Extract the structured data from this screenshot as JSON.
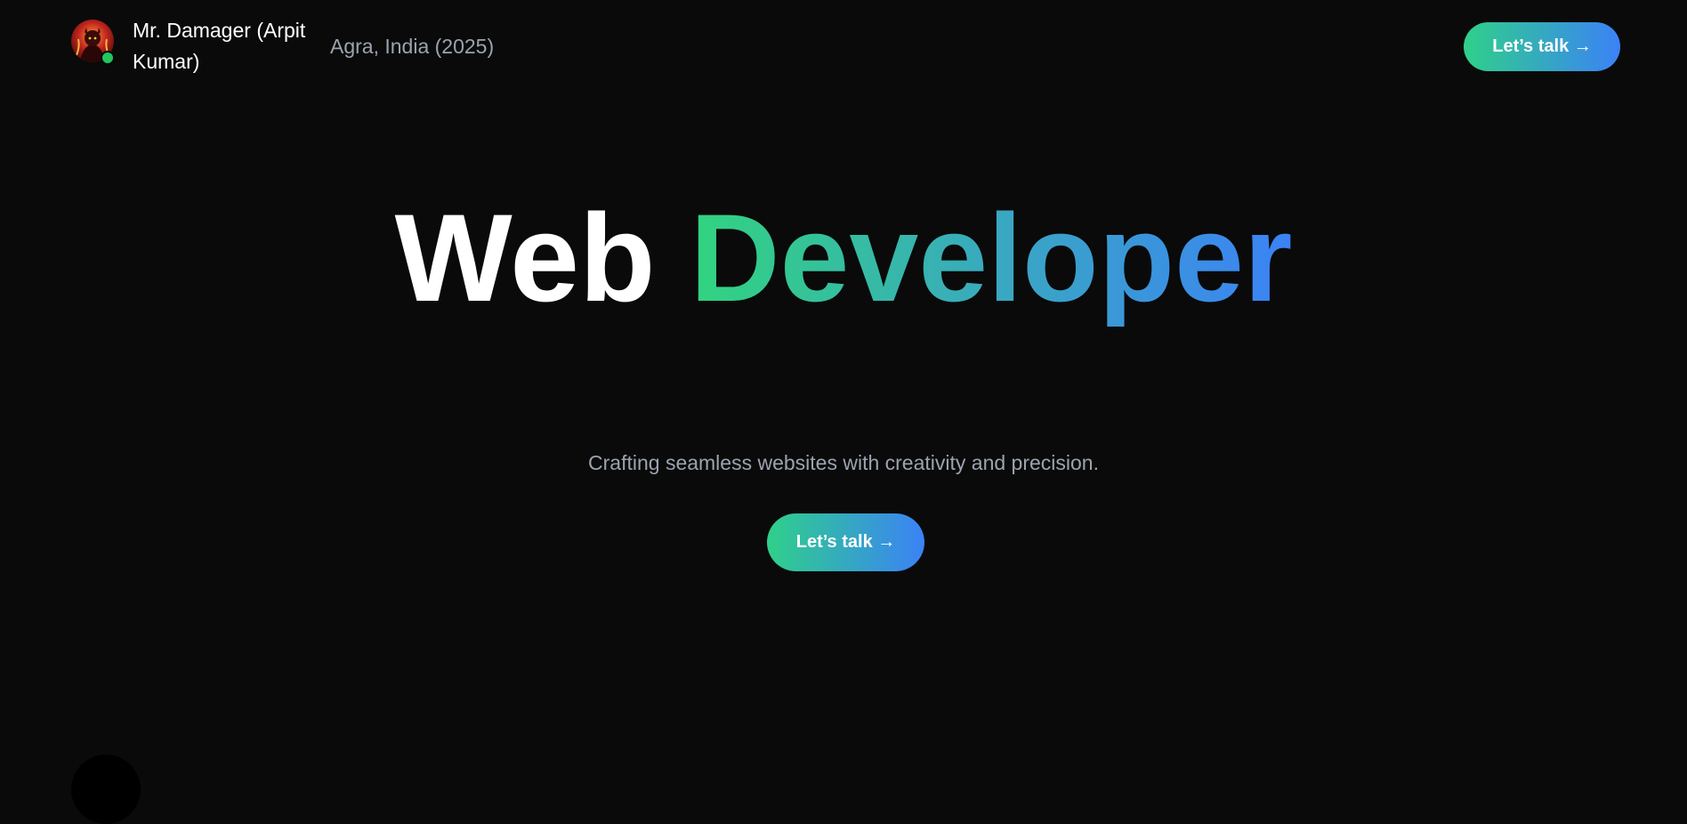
{
  "header": {
    "name": "Mr. Damager (Arpit Kumar)",
    "location": "Agra, India (2025)",
    "cta_label": "Let’s talk →",
    "avatar_icon": "avatar-illustration-icon",
    "status_color": "#22c55e"
  },
  "hero": {
    "title_part1": "Web ",
    "title_part2": "Developer",
    "subtitle": "Crafting seamless websites with creativity and precision.",
    "cta_label": "Let’s talk →"
  },
  "colors": {
    "background": "#0a0a0a",
    "accent_start": "#2fd08a",
    "accent_end": "#3b82f6",
    "muted_text": "#9ca3af"
  }
}
